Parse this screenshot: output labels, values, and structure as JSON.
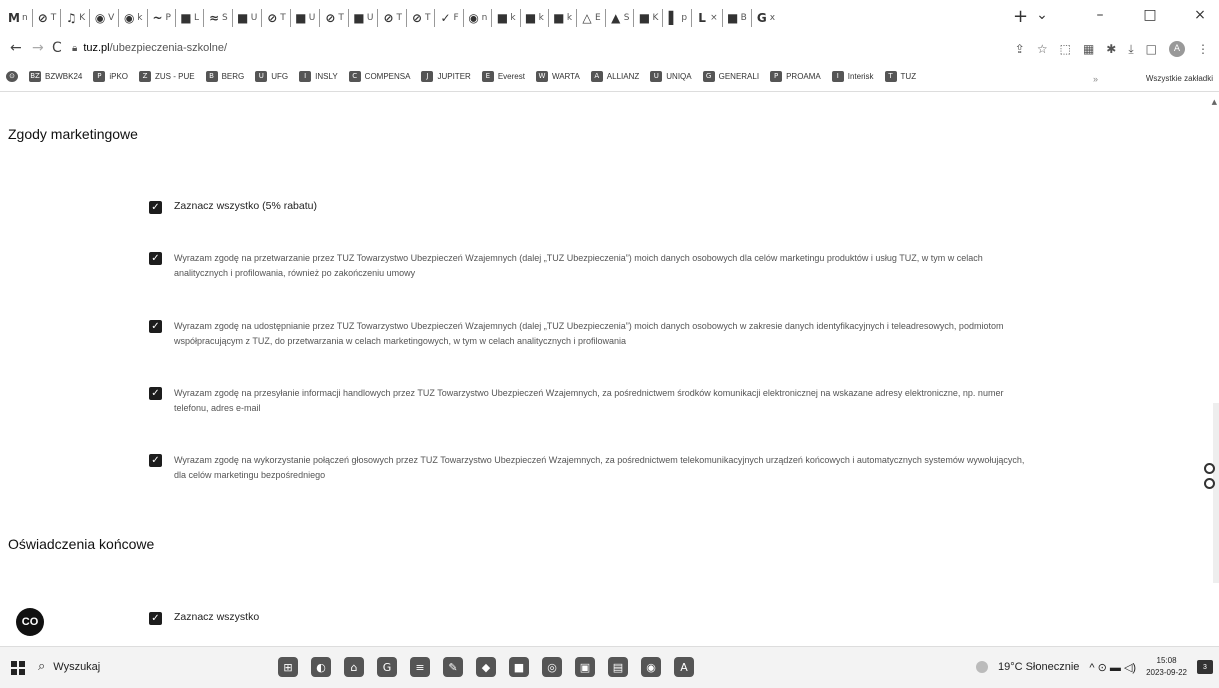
{
  "browser": {
    "tabs": [
      {
        "icon": "M",
        "label": "n"
      },
      {
        "icon": "⊘",
        "label": "T"
      },
      {
        "icon": "♫",
        "label": "K"
      },
      {
        "icon": "◉",
        "label": "V"
      },
      {
        "icon": "◉",
        "label": "k"
      },
      {
        "icon": "~",
        "label": "P"
      },
      {
        "icon": "■",
        "label": "L"
      },
      {
        "icon": "≈",
        "label": "S"
      },
      {
        "icon": "■",
        "label": "U"
      },
      {
        "icon": "⊘",
        "label": "T"
      },
      {
        "icon": "■",
        "label": "U"
      },
      {
        "icon": "⊘",
        "label": "T"
      },
      {
        "icon": "■",
        "label": "U"
      },
      {
        "icon": "⊘",
        "label": "T"
      },
      {
        "icon": "⊘",
        "label": "T"
      },
      {
        "icon": "✓",
        "label": "F"
      },
      {
        "icon": "◉",
        "label": "n"
      },
      {
        "icon": "■",
        "label": "k"
      },
      {
        "icon": "■",
        "label": "k"
      },
      {
        "icon": "■",
        "label": "k"
      },
      {
        "icon": "△",
        "label": "E"
      },
      {
        "icon": "▲",
        "label": "S"
      },
      {
        "icon": "■",
        "label": "K"
      },
      {
        "icon": "▌",
        "label": "p"
      },
      {
        "icon": "L",
        "label": "×"
      },
      {
        "icon": "■",
        "label": "B"
      },
      {
        "icon": "G",
        "label": "x"
      }
    ],
    "new_tab": "+",
    "window_controls": {
      "tablist": "⌄",
      "minimize": "–",
      "maximize": "□",
      "close": "×"
    },
    "nav": {
      "back": "←",
      "forward": "→",
      "reload": "C"
    },
    "url": {
      "host": "tuz.pl",
      "path": "/ubezpieczenia-szkolne/"
    },
    "bookmarks": [
      {
        "icon": "BZ",
        "label": "BZWBK24"
      },
      {
        "icon": "P",
        "label": "iPKO"
      },
      {
        "icon": "Z",
        "label": "ZUS - PUE"
      },
      {
        "icon": "B",
        "label": "BERG"
      },
      {
        "icon": "U",
        "label": "UFG"
      },
      {
        "icon": "I",
        "label": "INSLY"
      },
      {
        "icon": "C",
        "label": "COMPENSA"
      },
      {
        "icon": "J",
        "label": "JUPITER"
      },
      {
        "icon": "E",
        "label": "Everest"
      },
      {
        "icon": "W",
        "label": "WARTA"
      },
      {
        "icon": "A",
        "label": "ALLIANZ"
      },
      {
        "icon": "U",
        "label": "UNIQA"
      },
      {
        "icon": "G",
        "label": "GENERALI"
      },
      {
        "icon": "P",
        "label": "PROAMA"
      },
      {
        "icon": "I",
        "label": "Interisk"
      },
      {
        "icon": "T",
        "label": "TUZ"
      }
    ],
    "bookmarks_more": "»",
    "bookmarks_all": "Wszystkie zakładki"
  },
  "page": {
    "marketing_title": "Zgody marketingowe",
    "select_all_discount": "Zaznacz wszystko (5% rabatu)",
    "consents": [
      "Wyrazam zgodę na przetwarzanie przez TUZ Towarzystwo Ubezpieczeń Wzajemnych (dalej „TUZ Ubezpieczenia”) moich danych osobowych dla celów marketingu produktów i usług TUZ, w tym w celach analitycznych i profilowania, również po zakończeniu umowy",
      "Wyrazam zgodę na udostępnianie przez TUZ Towarzystwo Ubezpieczeń Wzajemnych (dalej „TUZ Ubezpieczenia”) moich danych osobowych w zakresie danych identyfikacyjnych i teleadresowych, podmiotom współpracującym z TUZ, do przetwarzania w celach marketingowych, w tym w celach analitycznych i profilowania",
      "Wyrazam zgodę na przesyłanie informacji handlowych przez TUZ Towarzystwo Ubezpieczeń Wzajemnych, za pośrednictwem środków komunikacji elektronicznej na wskazane adresy elektroniczne, np. numer telefonu, adres e-mail",
      "Wyrazam zgodę na wykorzystanie połączeń głosowych przez TUZ Towarzystwo Ubezpieczeń Wzajemnych, za pośrednictwem telekomunikacyjnych urządzeń końcowych i automatycznych systemów wywołujących, dla celów marketingu bezpośredniego"
    ],
    "final_title": "Oświadczenia końcowe",
    "select_all": "Zaznacz wszystko",
    "checkmark": "✓",
    "chat_label": "CO"
  },
  "taskbar": {
    "search_label": "Wyszukaj",
    "apps": [
      "⊞",
      "◐",
      "⌂",
      "G",
      "≡",
      "✎",
      "◆",
      "■",
      "◎",
      "▣",
      "▤",
      "◉",
      "A"
    ],
    "weather": "19°C Słonecznie",
    "tray_icons": "^ ⊙ ▬ ◁)",
    "time": "15:08",
    "date": "2023-09-22",
    "notifications": "3"
  }
}
